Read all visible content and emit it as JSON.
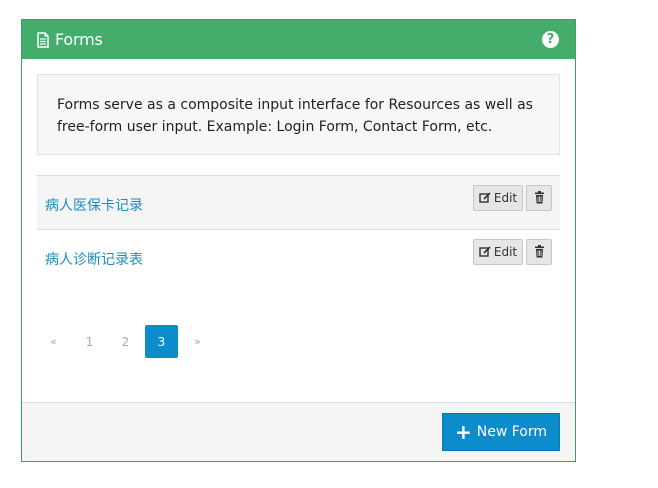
{
  "panel": {
    "title": "Forms",
    "icon": "file-text-icon",
    "help_icon": "question-circle-icon",
    "accent_color": "#44ad6c"
  },
  "description": "Forms serve as a composite input interface for Resources as well as free-form user input. Example: Login Form, Contact Form, etc.",
  "forms": [
    {
      "name": "病人医保卡记录",
      "edit_label": "Edit"
    },
    {
      "name": "病人诊断记录表",
      "edit_label": "Edit"
    }
  ],
  "pagination": {
    "prev": "«",
    "pages": [
      "1",
      "2",
      "3"
    ],
    "current": "3",
    "next": "»"
  },
  "footer": {
    "new_form_label": "New Form",
    "primary_color": "#0d8ccc"
  }
}
